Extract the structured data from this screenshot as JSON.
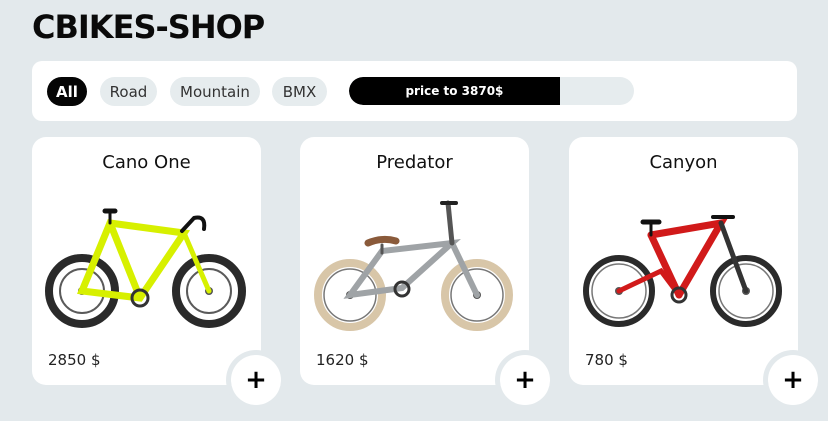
{
  "header": {
    "title": "CBIKES-SHOP"
  },
  "filters": {
    "chips": [
      "All",
      "Road",
      "Mountain",
      "BMX"
    ],
    "active": "All",
    "price": {
      "label": "price to 3870$",
      "value": 3870,
      "fill_fraction": 0.74
    }
  },
  "products": [
    {
      "name": "Cano One",
      "price": "2850 $",
      "frame_color": "#d7f000",
      "tire": "dark"
    },
    {
      "name": "Predator",
      "price": "1620 $",
      "frame_color": "#9fa3a6",
      "tire": "tan"
    },
    {
      "name": "Canyon",
      "price": "780 $",
      "frame_color": "#d11a1a",
      "tire": "dark"
    }
  ],
  "add_button": {
    "label": "+"
  }
}
